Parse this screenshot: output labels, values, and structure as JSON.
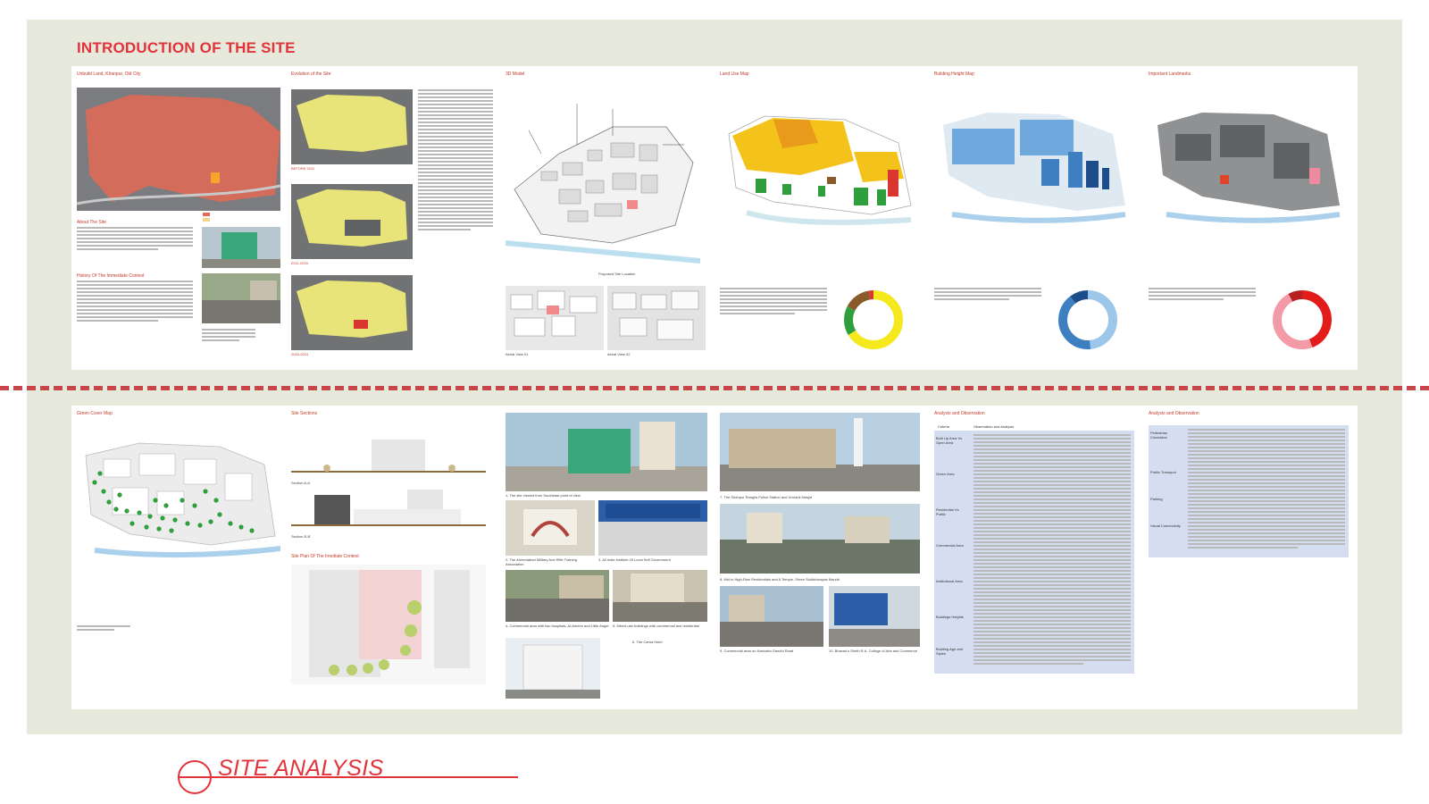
{
  "title": "INTRODUCTION OF THE SITE",
  "bottom_title": "SITE ANALYSIS",
  "captions": {
    "unbuild": "Unbuild Land, Khanpur, Old City",
    "evolution": "Evolution of the Site",
    "model3d": "3D Model",
    "landuse": "Land Use Map",
    "height": "Building Height Map",
    "landmarks": "Important Landmarks",
    "green": "Green Cover Map",
    "sections": "Site Sections",
    "siteplan": "Site Plan Of The Imediate Context",
    "analysis1": "Analysis and Observation",
    "analysis2": "Analysis and Observation",
    "about": "About The Site",
    "history": "History Of The Immediate Context"
  },
  "evolution_years": [
    "BEFORE 2011",
    "2011-2016",
    "2016-2024"
  ],
  "photo_captions": {
    "p1": "1. The site viewed from Southeast point of view",
    "p2": "2. The Ahmedabad Military And Rifle Training Association",
    "p3": "3. All India Institute Of Local Self Government",
    "p4": "4. Commercial area with two hospitals, Al-Ameen and Little Angel",
    "p5": "5. Mixed-use buildings with commercial and residential",
    "p6": "6. The Cama Hotel",
    "p7": "7. The Shahpur Rangila Police Station and Umrauli Masjid",
    "p8": "8. Mid to High-Rise Residentials and A Temple, Shree Siddhivinayak Mandir",
    "p9": "9. Commercial area on Kasturba Gandhi Road",
    "p10": "10. Bhavan's Sheth R.A. College of Arts and Commerce"
  },
  "section_labels": [
    "Section A-A'",
    "Section B-B'"
  ],
  "aerial_captions": [
    "Aerial View 01",
    "Aerial View 02"
  ],
  "analysis_table": {
    "headers": [
      "Criteria",
      "Observation and Analysis"
    ],
    "rows": [
      "Built Up Area Vs Open Area",
      "Green Area",
      "Residential Vs Public",
      "Commercial Area",
      "Institutional Area",
      "Buildings Heights",
      "Building Age and Styles"
    ]
  },
  "analysis_table2": {
    "rows": [
      "Pedestrian Circulation",
      "Public Transport",
      "Parking",
      "Visual Connectivity"
    ]
  },
  "colors": {
    "accent": "#e2333b",
    "sheet": "#e6e9dc",
    "landuse_yellow": "#f3c21b",
    "height_blue": "#6fa8dc",
    "green": "#2f9e3d"
  },
  "chart_landuse": {
    "type": "pie",
    "values": [
      66.3,
      16.1,
      14.8,
      2.8
    ]
  },
  "chart_height": {
    "type": "pie",
    "values": [
      48.4,
      41.2,
      10.4
    ]
  },
  "chart_landmarks": {
    "type": "pie",
    "values": [
      44.3,
      47.8,
      7.9
    ]
  }
}
